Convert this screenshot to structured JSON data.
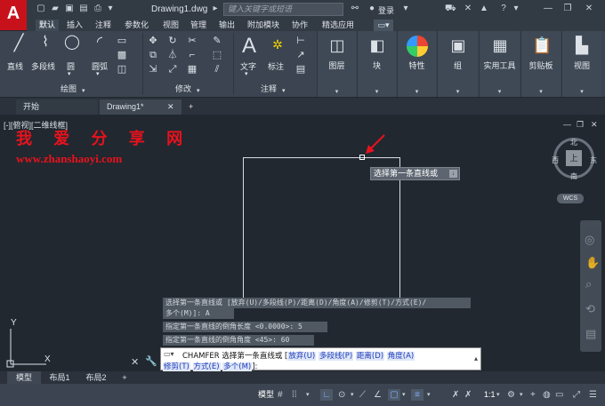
{
  "app": {
    "document_title": "Drawing1.dwg",
    "search_placeholder": "键入关键字或短语",
    "login_label": "登录"
  },
  "ribbon_tabs": [
    "默认",
    "插入",
    "注释",
    "参数化",
    "视图",
    "管理",
    "输出",
    "附加模块",
    "协作",
    "精选应用"
  ],
  "ribbon": {
    "draw_buttons": [
      "直线",
      "多段线",
      "圆",
      "圆弧"
    ],
    "draw_panel_label": "绘图",
    "modify_panel_label": "修改",
    "annotation_buttons": [
      "文字",
      "标注"
    ],
    "annotation_panel_label": "注释",
    "big_panels": [
      "图层",
      "块",
      "特性",
      "组",
      "实用工具",
      "剪贴板",
      "视图"
    ]
  },
  "file_tabs": [
    "开始",
    "Drawing1*"
  ],
  "viewport": {
    "label": "[-][俯视][二维线框]",
    "watermark_title": "我 爱 分 享 网",
    "watermark_url": "www.zhanshaoyi.com",
    "tooltip": "选择第一条直线或",
    "wcs_label": "WCS",
    "compass": {
      "n": "北",
      "s": "南",
      "e": "东",
      "w": "西",
      "top": "上"
    },
    "ucs_x": "X",
    "ucs_y": "Y"
  },
  "command_history": [
    "选择第一条直线或 [放弃(U)/多段线(P)/距离(D)/角度(A)/修剪(T)/方式(E)/",
    "多个(M)]:  A",
    "指定第一条直线的倒角长度 <0.0000>: 5",
    "指定第一条直线的倒角角度 <45>: 60"
  ],
  "command_line": {
    "prefix": "CHAMFER 选择第一条直线或 [",
    "options_line1": [
      "放弃(U)",
      "多段线(P)",
      "距离(D)",
      "角度(A)"
    ],
    "options_line2": [
      "修剪(T)",
      "方式(E)",
      "多个(M)"
    ],
    "suffix": "]:"
  },
  "layout_tabs": [
    "模型",
    "布局1",
    "布局2"
  ],
  "status_bar": {
    "model_label": "模型",
    "scale_label": "1:1"
  },
  "colors": {
    "accent": "#c8121b",
    "ribbon": "#3b4450",
    "canvas": "#212830"
  }
}
